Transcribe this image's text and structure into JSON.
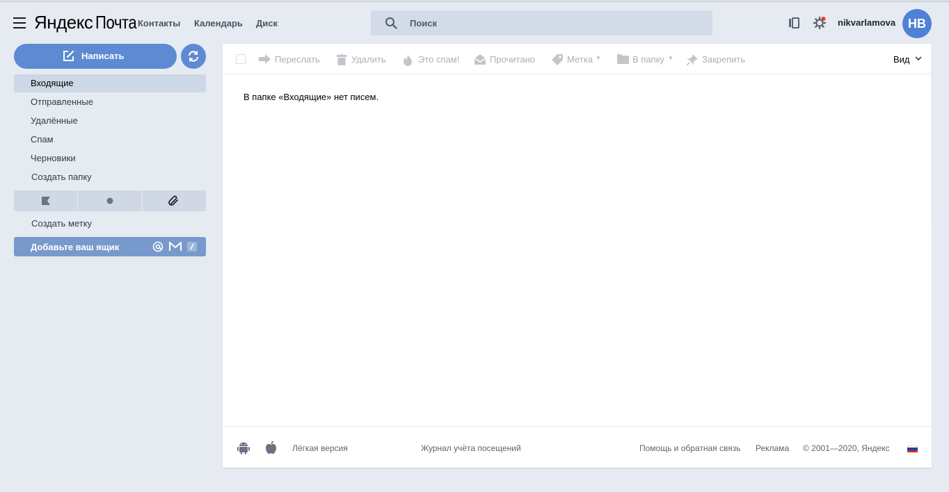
{
  "header": {
    "logo_yandex": "Яндекс",
    "logo_mail": "Почта",
    "services": [
      "Контакты",
      "Календарь",
      "Диск"
    ],
    "search_placeholder": "Поиск",
    "username": "nikvarlamova",
    "avatar_initials": "НВ",
    "icons": [
      "menu-icon",
      "search-icon",
      "themes-icon",
      "settings-icon"
    ],
    "notification_color": "#e53935"
  },
  "sidebar": {
    "compose_label": "Написать",
    "folders": [
      {
        "label": "Входящие",
        "active": true
      },
      {
        "label": "Отправленные"
      },
      {
        "label": "Удалённые"
      },
      {
        "label": "Спам"
      },
      {
        "label": "Черновики"
      },
      {
        "label": "Создать папку"
      }
    ],
    "label_filters": [
      "flag-icon",
      "dot-icon",
      "attachment-icon"
    ],
    "create_label": "Создать метку",
    "add_mailbox": "Добавьте ваш ящик",
    "add_mailbox_icons": [
      "at-icon",
      "gmail-icon",
      "slash-icon"
    ]
  },
  "toolbar": {
    "forward": "Переслать",
    "delete": "Удалить",
    "spam": "Это спам!",
    "read": "Прочитано",
    "label": "Метка",
    "to_folder": "В папку",
    "pin": "Закрепить",
    "view": "Вид"
  },
  "main": {
    "empty_message": "В папке «Входящие» нет писем."
  },
  "footer": {
    "lite_version": "Лёгкая версия",
    "visits_log": "Журнал учёта посещений",
    "help": "Помощь и обратная связь",
    "ads": "Реклама",
    "copyright": "© 2001—2020, Яндекс",
    "icons": [
      "android-icon",
      "apple-icon",
      "russian-flag-icon"
    ]
  },
  "colors": {
    "accent": "#5d8ad2",
    "background": "#e6ebf2",
    "avatar": "#4f81d6"
  }
}
